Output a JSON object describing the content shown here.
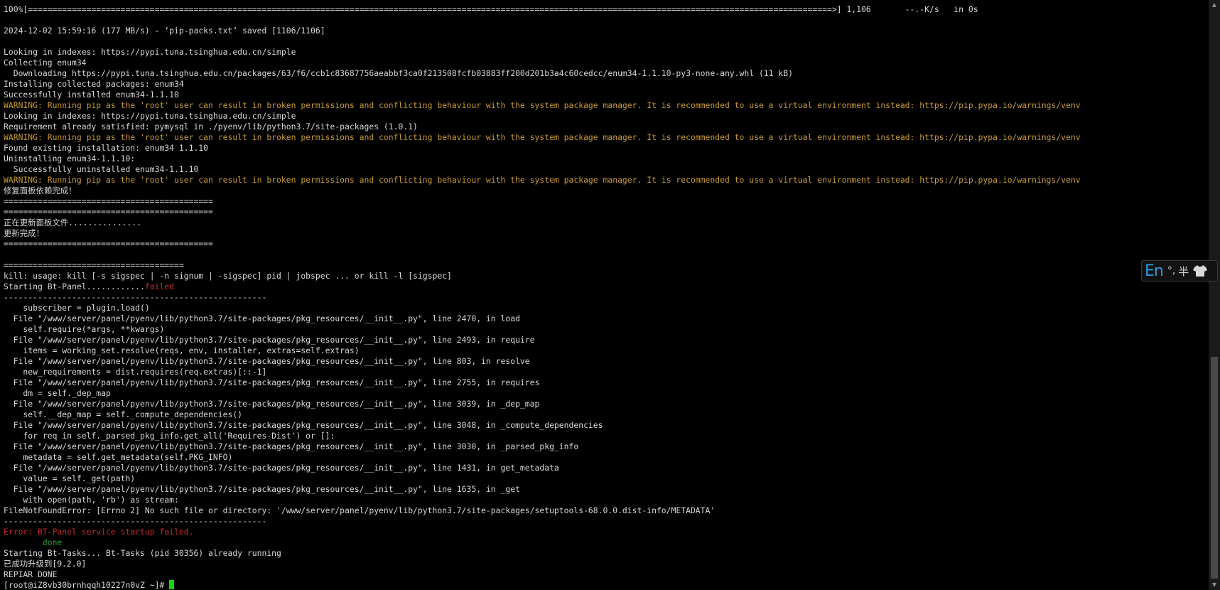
{
  "terminal": {
    "lines": [
      {
        "t": "100%[=====================================================================================================================================================================>] 1,106       --.-K/s   in 0s",
        "k": ""
      },
      {
        "t": "",
        "k": ""
      },
      {
        "t": "2024-12-02 15:59:16 (177 MB/s) - ‘pip-packs.txt’ saved [1106/1106]",
        "k": ""
      },
      {
        "t": "",
        "k": ""
      },
      {
        "t": "Looking in indexes: https://pypi.tuna.tsinghua.edu.cn/simple",
        "k": ""
      },
      {
        "t": "Collecting enum34",
        "k": ""
      },
      {
        "t": "  Downloading https://pypi.tuna.tsinghua.edu.cn/packages/63/f6/ccb1c83687756aeabbf3ca0f213508fcfb03883ff200d201b3a4c60cedcc/enum34-1.1.10-py3-none-any.whl (11 kB)",
        "k": ""
      },
      {
        "t": "Installing collected packages: enum34",
        "k": ""
      },
      {
        "t": "Successfully installed enum34-1.1.10",
        "k": ""
      },
      {
        "t": "WARNING: Running pip as the 'root' user can result in broken permissions and conflicting behaviour with the system package manager. It is recommended to use a virtual environment instead: https://pip.pypa.io/warnings/venv",
        "k": "warn"
      },
      {
        "t": "Looking in indexes: https://pypi.tuna.tsinghua.edu.cn/simple",
        "k": ""
      },
      {
        "t": "Requirement already satisfied: pymysql in ./pyenv/lib/python3.7/site-packages (1.0.1)",
        "k": ""
      },
      {
        "t": "WARNING: Running pip as the 'root' user can result in broken permissions and conflicting behaviour with the system package manager. It is recommended to use a virtual environment instead: https://pip.pypa.io/warnings/venv",
        "k": "warn"
      },
      {
        "t": "Found existing installation: enum34 1.1.10",
        "k": ""
      },
      {
        "t": "Uninstalling enum34-1.1.10:",
        "k": ""
      },
      {
        "t": "  Successfully uninstalled enum34-1.1.10",
        "k": ""
      },
      {
        "t": "WARNING: Running pip as the 'root' user can result in broken permissions and conflicting behaviour with the system package manager. It is recommended to use a virtual environment instead: https://pip.pypa.io/warnings/venv",
        "k": "warn"
      },
      {
        "t": "修复面板依赖完成！",
        "k": ""
      },
      {
        "t": "===========================================",
        "k": ""
      },
      {
        "t": "===========================================",
        "k": ""
      },
      {
        "t": "正在更新面板文件...............",
        "k": ""
      },
      {
        "t": "更新完成！",
        "k": ""
      },
      {
        "t": "===========================================",
        "k": ""
      },
      {
        "t": "",
        "k": ""
      },
      {
        "t": "=====================================",
        "k": ""
      },
      {
        "t": "kill: usage: kill [-s sigspec | -n signum | -sigspec] pid | jobspec ... or kill -l [sigspec]",
        "k": ""
      },
      {
        "t": "Starting Bt-Panel............",
        "k": "",
        "suffix": "failed",
        "sk": "err"
      },
      {
        "t": "------------------------------------------------------",
        "k": ""
      },
      {
        "t": "    subscriber = plugin.load()",
        "k": ""
      },
      {
        "t": "  File \"/www/server/panel/pyenv/lib/python3.7/site-packages/pkg_resources/__init__.py\", line 2470, in load",
        "k": ""
      },
      {
        "t": "    self.require(*args, **kwargs)",
        "k": ""
      },
      {
        "t": "  File \"/www/server/panel/pyenv/lib/python3.7/site-packages/pkg_resources/__init__.py\", line 2493, in require",
        "k": ""
      },
      {
        "t": "    items = working_set.resolve(reqs, env, installer, extras=self.extras)",
        "k": ""
      },
      {
        "t": "  File \"/www/server/panel/pyenv/lib/python3.7/site-packages/pkg_resources/__init__.py\", line 803, in resolve",
        "k": ""
      },
      {
        "t": "    new_requirements = dist.requires(req.extras)[::-1]",
        "k": ""
      },
      {
        "t": "  File \"/www/server/panel/pyenv/lib/python3.7/site-packages/pkg_resources/__init__.py\", line 2755, in requires",
        "k": ""
      },
      {
        "t": "    dm = self._dep_map",
        "k": ""
      },
      {
        "t": "  File \"/www/server/panel/pyenv/lib/python3.7/site-packages/pkg_resources/__init__.py\", line 3039, in _dep_map",
        "k": ""
      },
      {
        "t": "    self.__dep_map = self._compute_dependencies()",
        "k": ""
      },
      {
        "t": "  File \"/www/server/panel/pyenv/lib/python3.7/site-packages/pkg_resources/__init__.py\", line 3048, in _compute_dependencies",
        "k": ""
      },
      {
        "t": "    for req in self._parsed_pkg_info.get_all('Requires-Dist') or []:",
        "k": ""
      },
      {
        "t": "  File \"/www/server/panel/pyenv/lib/python3.7/site-packages/pkg_resources/__init__.py\", line 3030, in _parsed_pkg_info",
        "k": ""
      },
      {
        "t": "    metadata = self.get_metadata(self.PKG_INFO)",
        "k": ""
      },
      {
        "t": "  File \"/www/server/panel/pyenv/lib/python3.7/site-packages/pkg_resources/__init__.py\", line 1431, in get_metadata",
        "k": ""
      },
      {
        "t": "    value = self._get(path)",
        "k": ""
      },
      {
        "t": "  File \"/www/server/panel/pyenv/lib/python3.7/site-packages/pkg_resources/__init__.py\", line 1635, in _get",
        "k": ""
      },
      {
        "t": "    with open(path, 'rb') as stream:",
        "k": ""
      },
      {
        "t": "FileNotFoundError: [Errno 2] No such file or directory: '/www/server/panel/pyenv/lib/python3.7/site-packages/setuptools-68.0.0.dist-info/METADATA'",
        "k": ""
      },
      {
        "t": "------------------------------------------------------",
        "k": ""
      },
      {
        "t": "Error: BT-Panel service startup failed.",
        "k": "err"
      },
      {
        "t": "        done",
        "k": "ok"
      },
      {
        "t": "Starting Bt-Tasks... Bt-Tasks (pid 30356) already running",
        "k": ""
      },
      {
        "t": "已成功升级到[9.2.0]",
        "k": ""
      },
      {
        "t": "REPIAR DONE",
        "k": ""
      },
      {
        "t": "[root@iZ8vb30brnhqqh10227n0vZ ~]# ",
        "k": "",
        "cursor": true
      }
    ]
  },
  "ime": {
    "language": "En",
    "punctuation": "°,",
    "width": "半",
    "skin_icon": "shirt-icon"
  },
  "colors": {
    "background": "#000000",
    "text": "#d8d8d8",
    "warning": "#c79a2e",
    "error": "#c22a2a",
    "success": "#2f9a2f",
    "cursor": "#18d418",
    "ime_accent": "#2d9ad9"
  }
}
